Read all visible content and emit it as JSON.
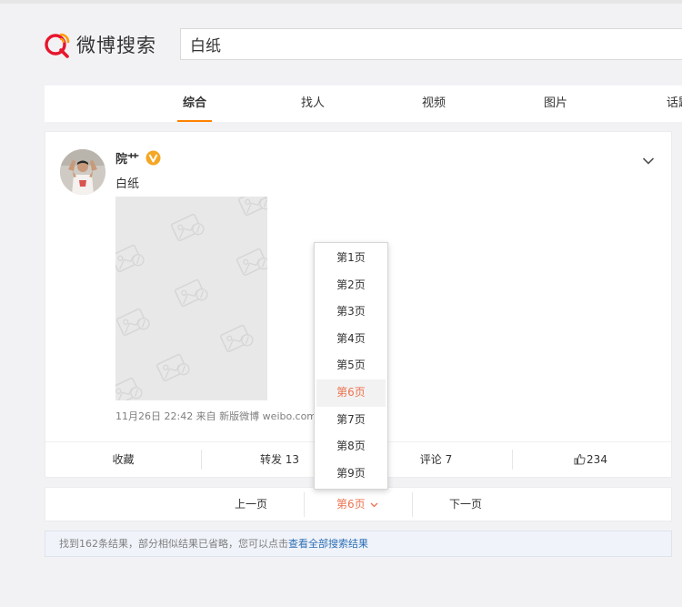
{
  "header": {
    "logo_text": "微博搜索",
    "search_value": "白纸"
  },
  "tabs": [
    {
      "label": "综合",
      "active": true
    },
    {
      "label": "找人",
      "active": false
    },
    {
      "label": "视频",
      "active": false
    },
    {
      "label": "图片",
      "active": false
    },
    {
      "label": "话题",
      "active": false
    }
  ],
  "post": {
    "username": "院艹",
    "text": "白纸",
    "meta": "11月26日 22:42  来自 新版微博 weibo.com",
    "actions": {
      "favorite": "收藏",
      "repost": "转发 13",
      "comment": "评论 7",
      "like": "234"
    }
  },
  "pager": {
    "prev": "上一页",
    "current": "第6页",
    "next": "下一页"
  },
  "dropdown": {
    "items": [
      "第1页",
      "第2页",
      "第3页",
      "第4页",
      "第5页",
      "第6页",
      "第7页",
      "第8页",
      "第9页"
    ],
    "selected_index": 5
  },
  "notice": {
    "text": "找到162条结果，部分相似结果已省略，您可以点击",
    "link": "查看全部搜索结果"
  },
  "colors": {
    "accent_orange": "#ff8200",
    "current_page": "#eb7350",
    "link_blue": "#2c6fb5",
    "verified_gold": "#f5a623",
    "logo_red": "#e6162d"
  }
}
